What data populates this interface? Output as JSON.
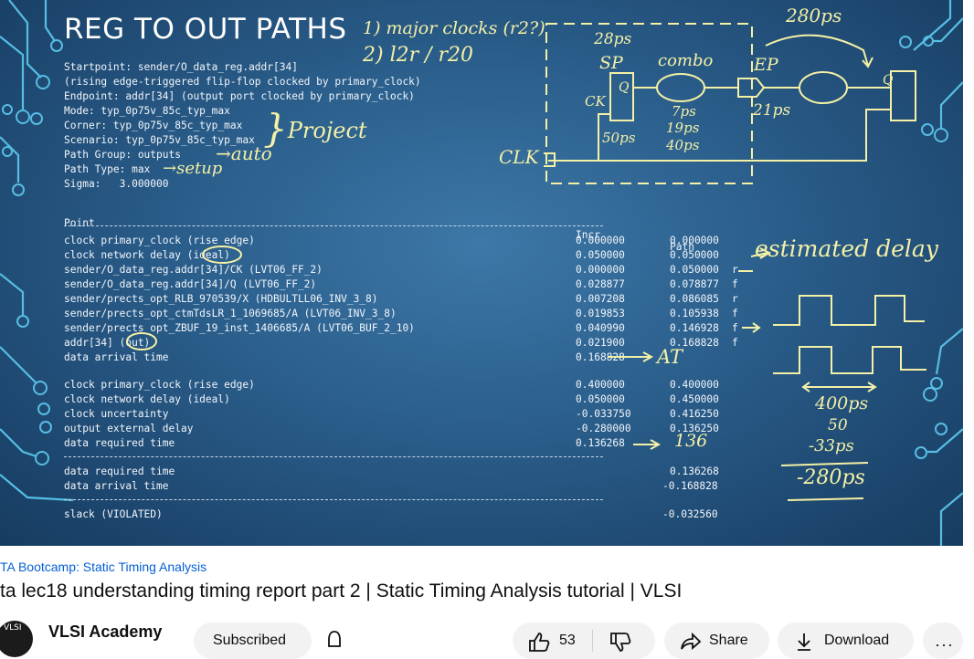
{
  "slide": {
    "title": "REG TO OUT PATHS",
    "header_lines": [
      "Startpoint: sender/O_data_reg.addr[34]",
      "(rising edge-triggered flip-flop clocked by primary_clock)",
      "Endpoint: addr[34] (output port clocked by primary_clock)",
      "Mode: typ_0p75v_85c_typ_max",
      "Corner: typ_0p75v_85c_typ_max",
      "Scenario: typ_0p75v_85c_typ_max",
      "Path Group: outputs",
      "Path Type: max",
      "Sigma:   3.000000"
    ],
    "columns": {
      "point": "Point",
      "incr": "Incr",
      "path": "Path"
    },
    "arrival_rows": [
      {
        "point": "clock primary_clock (rise edge)",
        "incr": "0.000000",
        "path": "0.000000",
        "flag": ""
      },
      {
        "point": "clock network delay (ideal)",
        "incr": "0.050000",
        "path": "0.050000",
        "flag": ""
      },
      {
        "point": "sender/O_data_reg.addr[34]/CK (LVT06_FF_2)",
        "incr": "0.000000",
        "path": "0.050000",
        "flag": "r"
      },
      {
        "point": "sender/O_data_reg.addr[34]/Q (LVT06_FF_2)",
        "incr": "0.028877",
        "path": "0.078877",
        "flag": "f"
      },
      {
        "point": "sender/prects_opt_RLB_970539/X (HDBULTLL06_INV_3_8)",
        "incr": "0.007208",
        "path": "0.086085",
        "flag": "r"
      },
      {
        "point": "sender/prects_opt_ctmTdsLR_1_1069685/A (LVT06_INV_3_8)",
        "incr": "0.019853",
        "path": "0.105938",
        "flag": "f"
      },
      {
        "point": "sender/prects_opt_ZBUF_19_inst_1406685/A (LVT06_BUF_2_10)",
        "incr": "0.040990",
        "path": "0.146928",
        "flag": "f"
      },
      {
        "point": "addr[34] (out)",
        "incr": "0.021900",
        "path": "0.168828",
        "flag": "f"
      },
      {
        "point": "data arrival time",
        "incr": "0.168828",
        "path": "",
        "flag": ""
      }
    ],
    "required_rows": [
      {
        "point": "clock primary_clock (rise edge)",
        "incr": "0.400000",
        "path": "0.400000"
      },
      {
        "point": "clock network delay (ideal)",
        "incr": "0.050000",
        "path": "0.450000"
      },
      {
        "point": "clock uncertainty",
        "incr": "-0.033750",
        "path": "0.416250"
      },
      {
        "point": "output external delay",
        "incr": "-0.280000",
        "path": "0.136250"
      },
      {
        "point": "data required time",
        "incr": "0.136268",
        "path": ""
      }
    ],
    "summary_rows": [
      {
        "point": "data required time",
        "path": "0.136268"
      },
      {
        "point": "data arrival time",
        "path": "-0.168828"
      }
    ],
    "slack": {
      "point": "slack (VIOLATED)",
      "path": "-0.032560"
    },
    "annotations": {
      "clocks_1": "1) major clocks (r2?)",
      "clocks_2": "2) l2r / r20",
      "project": "Project",
      "auto": "auto",
      "setup": "setup",
      "t280": "280ps",
      "t28": "28ps",
      "sp": "SP",
      "combo": "combo",
      "ep": "EP",
      "q1": "Q",
      "ck": "CK",
      "q2": "Q",
      "d7": "7ps",
      "d19": "19ps",
      "d40": "40ps",
      "d21": "21ps",
      "d50": "50ps",
      "clk": "CLK",
      "estimated": "estimated delay",
      "at": "AT",
      "v136": "136",
      "v400": "400ps",
      "v50": "50",
      "v33": "-33ps",
      "v280": "-280ps"
    }
  },
  "video": {
    "playlist": "TA Bootcamp: Static Timing Analysis",
    "title": "ta lec18 understanding timing report part 2 | Static Timing Analysis tutorial | VLSI",
    "channel": "VLSI Academy",
    "avatar_text": "VLSI",
    "subscribe_label": "Subscribed",
    "like_count": "53",
    "share_label": "Share",
    "download_label": "Download"
  },
  "colors": {
    "annotation": "#f4f0a6",
    "link": "#065fd4",
    "circuit": "#59c3e8"
  }
}
